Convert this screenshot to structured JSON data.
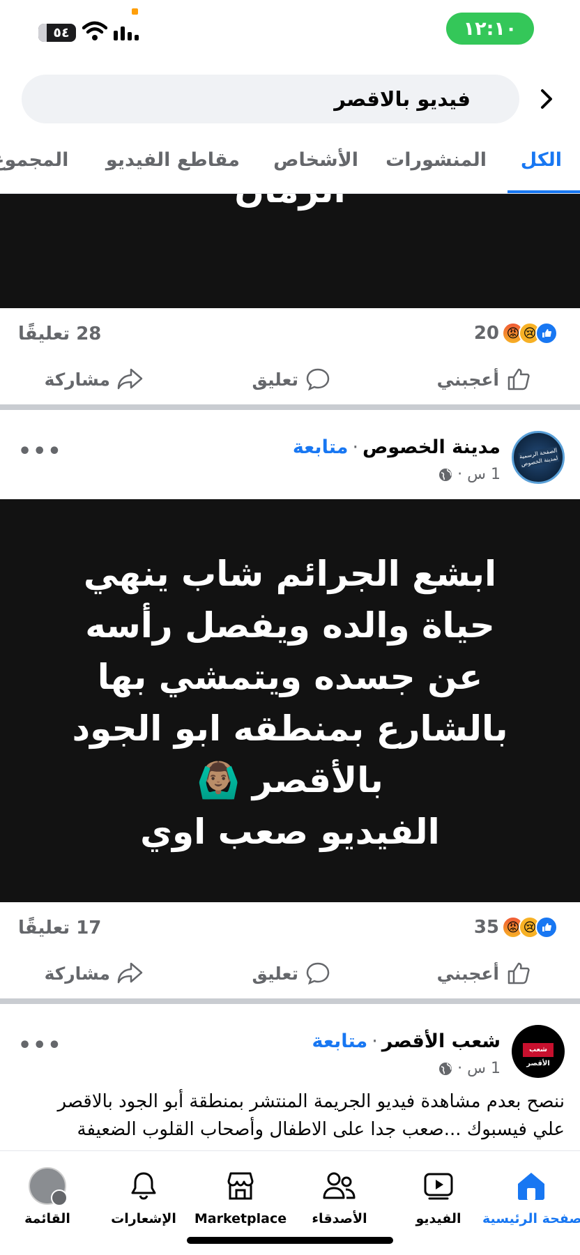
{
  "status_bar": {
    "time": "١٢:١٠",
    "battery": "٥٤"
  },
  "search": {
    "query": "فيديو بالاقصر"
  },
  "tabs": [
    {
      "label": "الكل",
      "active": true
    },
    {
      "label": "المنشورات"
    },
    {
      "label": "الأشخاص"
    },
    {
      "label": "مقاطع الفيديو"
    },
    {
      "label": "المجموع"
    }
  ],
  "post1": {
    "media_text": "الزمان",
    "reactions_count": "20",
    "comments": "28 تعليقًا"
  },
  "actions": {
    "like": "أعجبني",
    "comment": "تعليق",
    "share": "مشاركة"
  },
  "post2": {
    "page_name": "مدينة الخصوص",
    "follow": "متابعة",
    "separator": "·",
    "time": "1 س ·",
    "avatar_text": "الصفحة الرسمية لمدينة الخصوص",
    "media_lines": [
      "ابشع الجرائم شاب ينهي",
      "حياة والده ويفصل رأسه",
      "عن جسده ويتمشي بها",
      "بالشارع بمنطقه ابو الجود",
      "بالأقصر 🙆🏽‍♂️",
      "الفيديو صعب اوي"
    ],
    "reactions_count": "35",
    "comments": "17 تعليقًا"
  },
  "post3": {
    "page_name": "شعب الأقصر",
    "follow": "متابعة",
    "separator": "·",
    "time": "1 س ·",
    "avatar_text": "شعب الأقصر",
    "text": "ننصح بعدم مشاهدة فيديو الجريمة المنتشر بمنطقة أبو الجود بالاقصر علي فيسبوك ...صعب جدا على الاطفال وأصحاب القلوب الضعيفة"
  },
  "bottom_nav": [
    {
      "label": "الصفحة الرئيسية",
      "icon": "home-icon",
      "active": true
    },
    {
      "label": "الفيديو",
      "icon": "video-icon"
    },
    {
      "label": "الأصدقاء",
      "icon": "friends-icon"
    },
    {
      "label": "Marketplace",
      "icon": "marketplace-icon"
    },
    {
      "label": "الإشعارات",
      "icon": "bell-icon"
    },
    {
      "label": "القائمة",
      "icon": "menu-avatar-icon"
    }
  ],
  "colors": {
    "accent": "#1877f2",
    "status_green": "#34c759",
    "media_bg": "#121212"
  }
}
